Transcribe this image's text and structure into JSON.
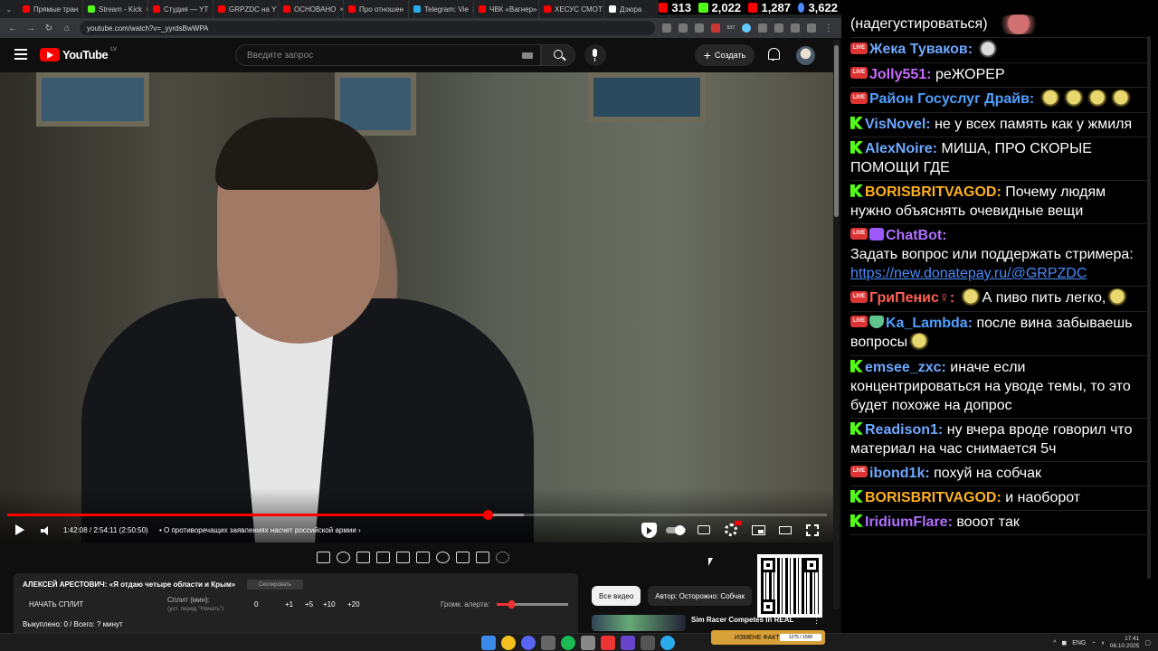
{
  "browser": {
    "tabs": [
      {
        "label": "Прямые тран",
        "color": "#ff0000"
      },
      {
        "label": "Stream - Kick",
        "color": "#53fc18"
      },
      {
        "label": "Студия — YT",
        "color": "#ff0000"
      },
      {
        "label": "GRPZDC на Y",
        "color": "#ff0000"
      },
      {
        "label": "ОСНОВАНО",
        "color": "#ff0000"
      },
      {
        "label": "Про отношен",
        "color": "#ff0000"
      },
      {
        "label": "Telegram: Vie",
        "color": "#2aabee"
      },
      {
        "label": "ЧВК «Вагнер»",
        "color": "#ff0000"
      },
      {
        "label": "ХЕСУС СМОТ",
        "color": "#ff0000"
      },
      {
        "label": "Дзюра",
        "color": "#ffffff"
      }
    ],
    "url": "youtube.com/watch?v=_yyrdsBwWPA",
    "ext_badge": "537"
  },
  "viewers": [
    {
      "platform": "youtube",
      "count": "313",
      "color": "#ff0000"
    },
    {
      "platform": "kick",
      "count": "2,022",
      "color": "#53fc18"
    },
    {
      "platform": "youtube",
      "count": "1,287",
      "color": "#ff0000"
    },
    {
      "platform": "total",
      "count": "3,622",
      "color": "#4a8cff"
    }
  ],
  "youtube": {
    "logo_text": "YouTube",
    "country": "LV",
    "search_placeholder": "Введите запрос",
    "create_label": "Создать"
  },
  "player": {
    "time": "1:42:08 / 2:54:11 (2:50:50)",
    "chapter": "• О противоречащих заявлениях насчет российской армии",
    "chapter_arrow": "›",
    "progress_played": 0.586,
    "progress_buffered": 0.63
  },
  "split_panel": {
    "title": "АЛЕКСЕЙ АРЕСТОВИЧ: «Я отдаю четыре области и Крым»",
    "copy_button": "Скопировать",
    "start_split": "НАЧАТЬ СПЛИТ",
    "split_label": "Сплит (мин):",
    "split_hint": "(уст. перед \"Начать\")",
    "split_value": "0",
    "increments": [
      "+1",
      "+5",
      "+10",
      "+20"
    ],
    "alert_volume_label": "Громк. алерта:",
    "alert_volume": 0.2,
    "bought_line": "Выкуплено: 0 / Всего: ? минут"
  },
  "recommendations": {
    "chips": [
      "Все видео",
      "Автор: Осторожно: Собчак"
    ],
    "first_title": "Sim Racer Competes In REAL",
    "menu_glyph": "⋮"
  },
  "chat": {
    "messages": [
      {
        "platform": "none",
        "nick": "",
        "nick_color": "#ffffff",
        "text": "(надегустироваться)",
        "emotes": "red"
      },
      {
        "platform": "yt",
        "nick": "Жека Туваков:",
        "nick_color": "#6ea8ff",
        "text": "",
        "emotes": "skull"
      },
      {
        "platform": "yt",
        "nick": "Jolly551:",
        "nick_color": "#c86bff",
        "text": "реЖОРЕР",
        "emotes": ""
      },
      {
        "platform": "yt",
        "nick": "Район Госуслуг Драйв:",
        "nick_color": "#4fa0ff",
        "text": "",
        "emotes": "yellow4"
      },
      {
        "platform": "kick",
        "nick": "VisNovel:",
        "nick_color": "#6ea8ff",
        "text": "не у всех память как у жмиля",
        "emotes": ""
      },
      {
        "platform": "kick",
        "nick": "AlexNoire:",
        "nick_color": "#6ea8ff",
        "text": "МИША, ПРО СКОРЫЕ ПОМОЩИ ГДЕ",
        "emotes": ""
      },
      {
        "platform": "kick",
        "nick": "BORISBRITVAGOD:",
        "nick_color": "#ffb020",
        "text": "Почему людям нужно объяснять очевидные вещи",
        "emotes": ""
      },
      {
        "platform": "yt-bot",
        "nick": "ChatBot:",
        "nick_color": "#b070ff",
        "text": "Задать вопрос или поддержать стримера:",
        "link": "https://new.donatepay.ru/@GRPZDC",
        "emotes": ""
      },
      {
        "platform": "yt",
        "nick": "ГриПенис♀:",
        "nick_color": "#ff6050",
        "text": "А пиво пить легко,",
        "emotes": "yellow-around"
      },
      {
        "platform": "yt-mod",
        "nick": "Ka_Lambda:",
        "nick_color": "#4fa0ff",
        "text": "после вина забываешь вопросы",
        "emotes": "yellow1"
      },
      {
        "platform": "kick",
        "nick": "emsee_zxc:",
        "nick_color": "#6ea8ff",
        "text": "иначе если концентрироваться на уводе темы, то это будет похоже на допрос",
        "emotes": ""
      },
      {
        "platform": "kick",
        "nick": "Readison1:",
        "nick_color": "#6ea8ff",
        "text": "ну вчера вроде говорил что материал на час снимается 5ч",
        "emotes": ""
      },
      {
        "platform": "yt",
        "nick": "ibond1k:",
        "nick_color": "#6ea8ff",
        "text": "похуй на собчак",
        "emotes": ""
      },
      {
        "platform": "kick",
        "nick": "BORISBRITVAGOD:",
        "nick_color": "#ffb020",
        "text": "и наоборот",
        "emotes": ""
      },
      {
        "platform": "kick",
        "nick": "IridiumFlare:",
        "nick_color": "#b070ff",
        "text": "вооот так",
        "emotes": ""
      }
    ]
  },
  "taskbar": {
    "widget_label": "ИЗМЕНЕ ФАКТЫ",
    "widget_progress": "1275 / 1500",
    "lang": "ENG",
    "time": "17:41",
    "date": "06.10.2025"
  }
}
